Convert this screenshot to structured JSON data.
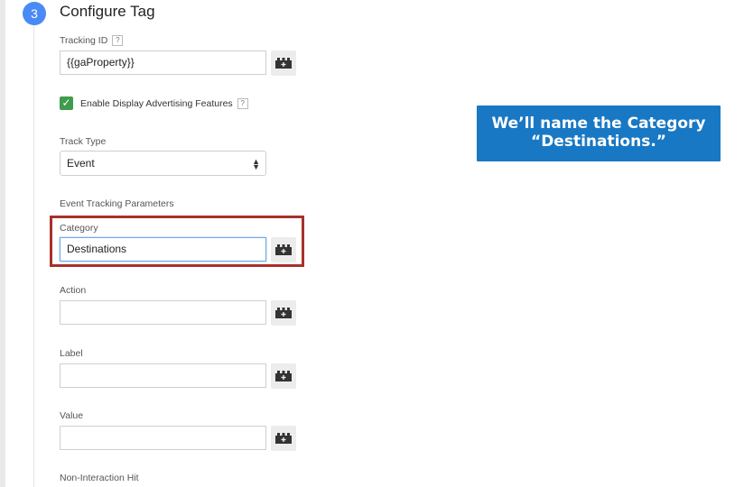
{
  "step": {
    "number": "3",
    "title": "Configure Tag"
  },
  "tracking_id": {
    "label": "Tracking ID",
    "help": "?",
    "value": "{{gaProperty}}"
  },
  "display_ads": {
    "label": "Enable Display Advertising Features",
    "help": "?",
    "checked": true,
    "check_glyph": "✓"
  },
  "track_type": {
    "label": "Track Type",
    "value": "Event",
    "arrows": "▲\n▼"
  },
  "event_params": {
    "heading": "Event Tracking Parameters",
    "category": {
      "label": "Category",
      "value": "Destinations"
    },
    "action": {
      "label": "Action",
      "value": ""
    },
    "label": {
      "label": "Label",
      "value": ""
    },
    "value": {
      "label": "Value",
      "value": ""
    }
  },
  "non_interaction": {
    "label": "Non-Interaction Hit"
  },
  "callout": {
    "line1": "We’ll name the Category",
    "line2": "“Destinations.”"
  },
  "colors": {
    "step_badge": "#4a8af4",
    "checkbox": "#3f9c4e",
    "highlight": "#a9302a",
    "callout": "#1878c4"
  },
  "icons": {
    "variable_button": "lego-brick-plus-icon"
  }
}
